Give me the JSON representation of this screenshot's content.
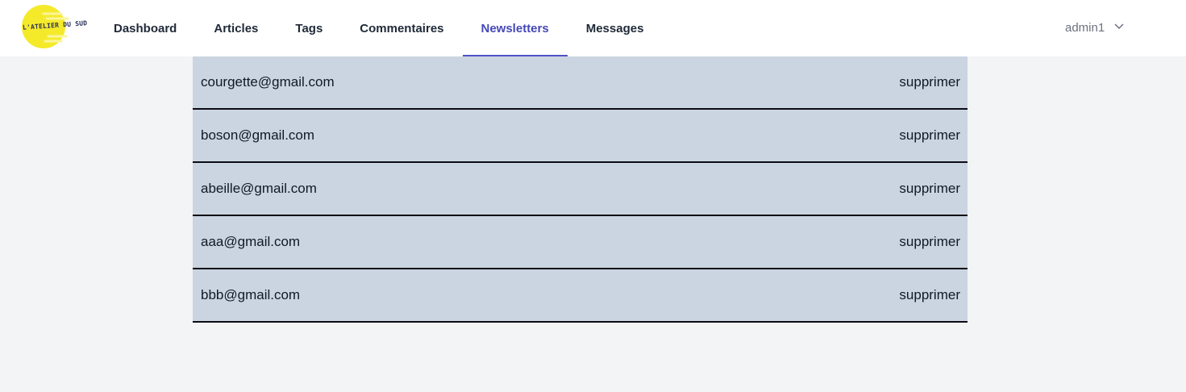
{
  "header": {
    "logo_text": "L'ATELIER DU SUD",
    "nav": [
      {
        "label": "Dashboard"
      },
      {
        "label": "Articles"
      },
      {
        "label": "Tags"
      },
      {
        "label": "Commentaires"
      },
      {
        "label": "Newsletters",
        "active": true
      },
      {
        "label": "Messages"
      }
    ],
    "user": {
      "name": "admin1",
      "icon": "chevron-down-icon"
    }
  },
  "subscribers": {
    "delete_label": "supprimer",
    "rows": [
      {
        "email": "courgette@gmail.com"
      },
      {
        "email": "boson@gmail.com"
      },
      {
        "email": "abeille@gmail.com"
      },
      {
        "email": "aaa@gmail.com"
      },
      {
        "email": "bbb@gmail.com"
      }
    ]
  },
  "colors": {
    "active_nav": "#4548b8",
    "row_bg": "#cbd5e1",
    "page_bg": "#f3f4f6",
    "logo_yellow": "#f5ea2a"
  }
}
